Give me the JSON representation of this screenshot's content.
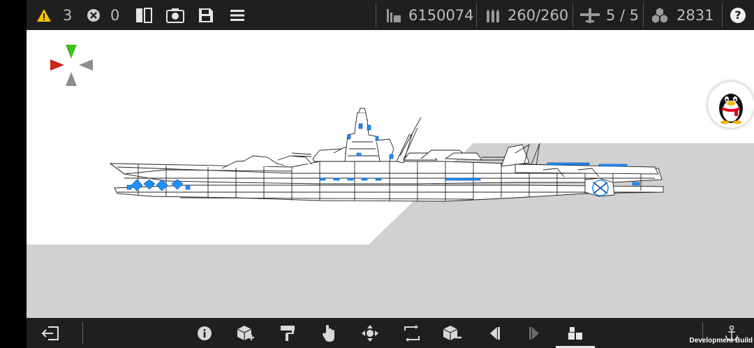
{
  "topbar": {
    "warning_count": "3",
    "error_count": "0",
    "displacement": "6150074",
    "ammo": "260/260",
    "aircraft": "5 / 5",
    "parts": "2831",
    "help_label": "?"
  },
  "bottombar": {
    "dev_build": "Development Build"
  },
  "colors": {
    "bar_bg": "#1f1f1f",
    "ground": "#d1d1d1",
    "sky": "#ffffff",
    "accent_blue": "#1e90ff",
    "gizmo_green": "#3ec11b",
    "gizmo_red": "#c7261b",
    "gizmo_grey": "#8d8d8d",
    "warning_yellow": "#f5c400"
  },
  "icons": {
    "top": [
      "warning-icon",
      "error-icon",
      "split-view-icon",
      "screenshot-icon",
      "save-icon",
      "menu-icon",
      "displacement-icon",
      "ammo-icon",
      "aircraft-icon",
      "parts-icon",
      "help-icon"
    ],
    "bottom": [
      "exit-icon",
      "info-icon",
      "add-part-icon",
      "paint-icon",
      "hand-icon",
      "move-icon",
      "rotate-icon",
      "remove-part-icon",
      "undo-icon",
      "redo-icon",
      "build-icon",
      "anchor-icon"
    ]
  }
}
